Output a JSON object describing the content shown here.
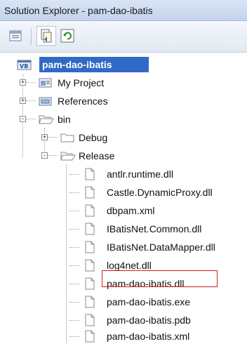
{
  "window": {
    "title": "Solution Explorer - pam-dao-ibatis"
  },
  "toolbar": {
    "buttons": [
      {
        "icon": "properties-icon",
        "active": false
      },
      {
        "icon": "show-all-files-icon",
        "active": true
      },
      {
        "icon": "refresh-icon",
        "active": false
      }
    ]
  },
  "tree": {
    "root": {
      "label": "pam-dao-ibatis",
      "icon": "vb-project-icon",
      "selected": true
    },
    "items": [
      {
        "label": "My Project",
        "icon": "my-project-icon",
        "expander": "+"
      },
      {
        "label": "References",
        "icon": "references-icon",
        "expander": "+"
      },
      {
        "label": "bin",
        "icon": "folder-open-icon",
        "expander": "-"
      },
      {
        "label": "Debug",
        "icon": "folder-icon",
        "expander": "+"
      },
      {
        "label": "Release",
        "icon": "folder-open-icon",
        "expander": "-"
      }
    ],
    "files": [
      "antlr.runtime.dll",
      "Castle.DynamicProxy.dll",
      "dbpam.xml",
      "IBatisNet.Common.dll",
      "IBatisNet.DataMapper.dll",
      "log4net.dll",
      "pam-dao-ibatis.dll",
      "pam-dao-ibatis.exe",
      "pam-dao-ibatis.pdb",
      "pam-dao-ibatis.xml"
    ],
    "highlighted_file": "pam-dao-ibatis.dll",
    "highlight_color": "#d11c1c",
    "selection_color": "#3169c6"
  }
}
